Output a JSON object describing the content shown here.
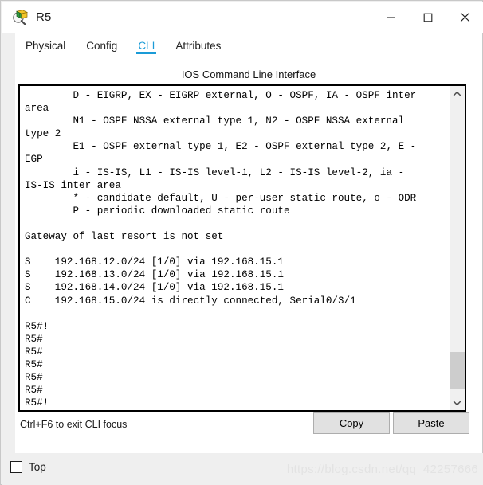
{
  "window": {
    "title": "R5",
    "icon": "packet-tracer-inspect-icon",
    "controls": {
      "minimize": "minimize-icon",
      "maximize": "maximize-icon",
      "close": "close-icon"
    }
  },
  "tabs": [
    {
      "label": "Physical",
      "active": false
    },
    {
      "label": "Config",
      "active": false
    },
    {
      "label": "CLI",
      "active": true
    },
    {
      "label": "Attributes",
      "active": false
    }
  ],
  "panel": {
    "title": "IOS Command Line Interface",
    "console_text": "        D - EIGRP, EX - EIGRP external, O - OSPF, IA - OSPF inter\narea\n        N1 - OSPF NSSA external type 1, N2 - OSPF NSSA external\ntype 2\n        E1 - OSPF external type 1, E2 - OSPF external type 2, E -\nEGP\n        i - IS-IS, L1 - IS-IS level-1, L2 - IS-IS level-2, ia -\nIS-IS inter area\n        * - candidate default, U - per-user static route, o - ODR\n        P - periodic downloaded static route\n\nGateway of last resort is not set\n\nS    192.168.12.0/24 [1/0] via 192.168.15.1\nS    192.168.13.0/24 [1/0] via 192.168.15.1\nS    192.168.14.0/24 [1/0] via 192.168.15.1\nC    192.168.15.0/24 is directly connected, Serial0/3/1\n\nR5#!\nR5#\nR5#\nR5#\nR5#\nR5#\nR5#!",
    "hint": "Ctrl+F6 to exit CLI focus",
    "buttons": {
      "copy": "Copy",
      "paste": "Paste"
    },
    "scrollbar": {
      "up_icon": "chevron-up-icon",
      "down_icon": "chevron-down-icon"
    }
  },
  "bottom": {
    "top_checkbox_label": "Top",
    "top_checkbox_checked": false,
    "watermark": "https://blog.csdn.net/qq_42257666"
  },
  "colors": {
    "accent": "#1a9bd7",
    "panel_bg": "#ffffff",
    "window_bg": "#efefef",
    "button_bg": "#e1e1e1",
    "scroll_thumb": "#cdcdcd"
  }
}
